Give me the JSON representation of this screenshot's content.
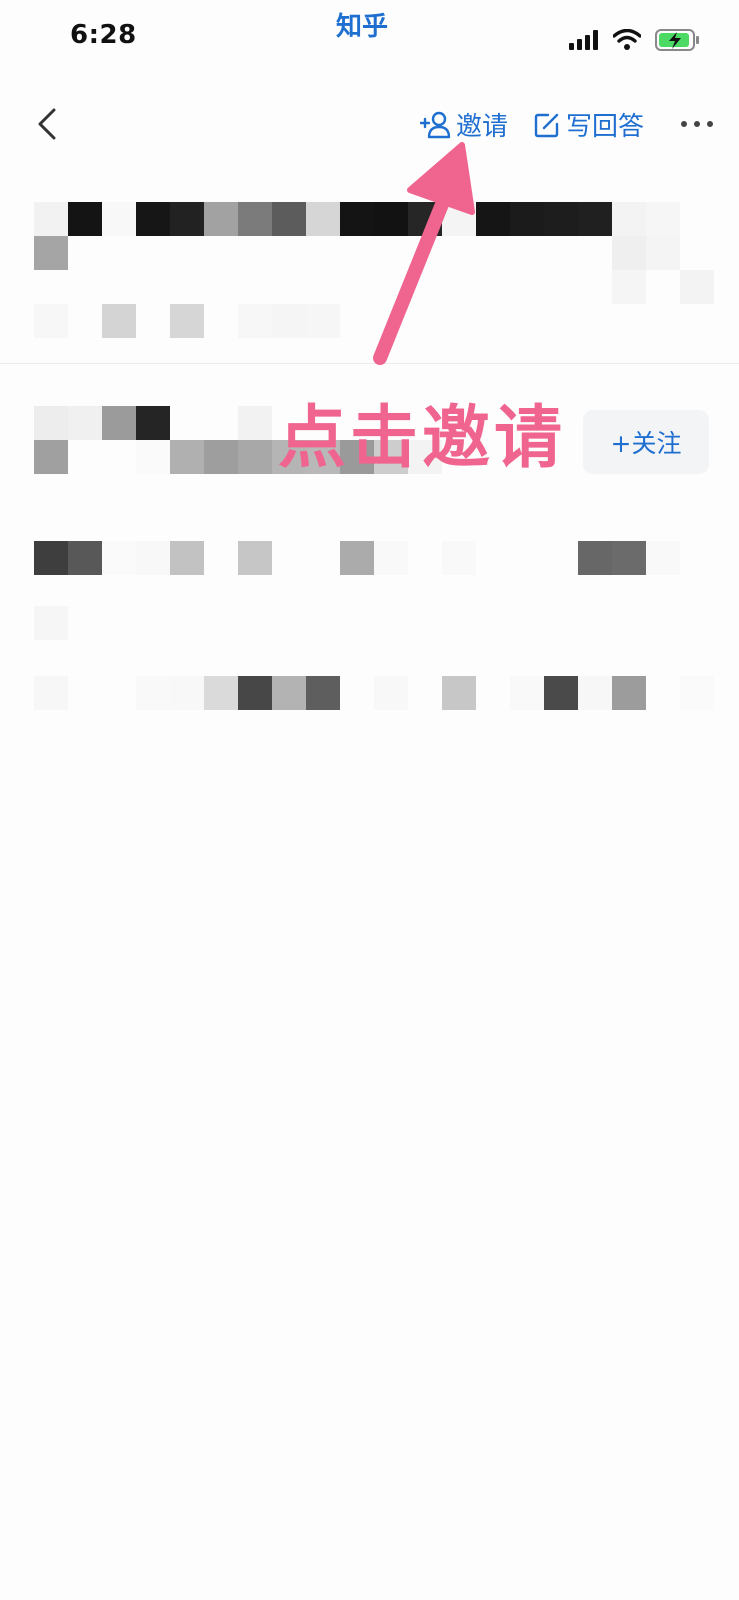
{
  "status_bar": {
    "time": "6:28",
    "app_name": "知乎"
  },
  "nav": {
    "invite_label": "邀请",
    "write_label": "写回答",
    "icons": [
      "chevron-left-icon",
      "add-person-icon",
      "edit-icon",
      "more-horizontal-icon"
    ]
  },
  "question": {
    "follow_label": "+关注"
  },
  "annotation": {
    "text": "点击邀请",
    "color": "#f06590"
  },
  "colors": {
    "accent": "#1f6fd1",
    "background": "#fdfdfd"
  }
}
